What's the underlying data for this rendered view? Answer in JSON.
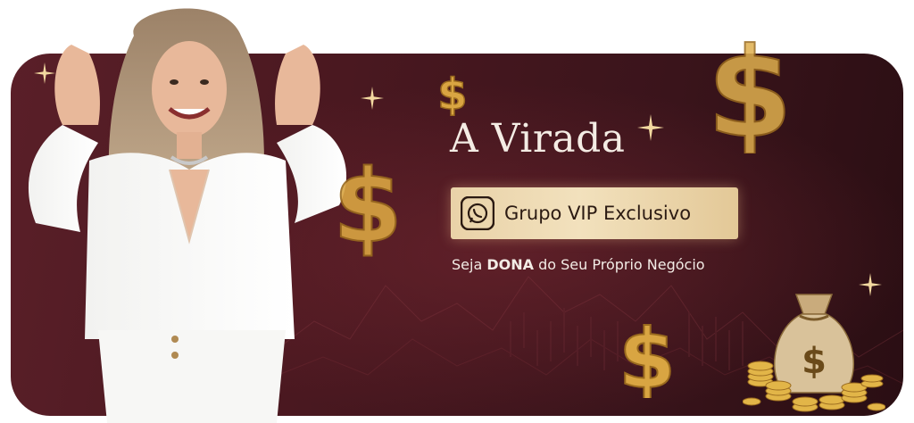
{
  "banner": {
    "title": "A Virada",
    "button_label": "Grupo VIP Exclusivo",
    "button_icon": "whatsapp-icon",
    "tagline_prefix": "Seja ",
    "tagline_bold": "DONA",
    "tagline_suffix": " do Seu Próprio Negócio"
  },
  "colors": {
    "background": "#4a1820",
    "button_gold": "#ecd6ad",
    "text_light": "#f4ece4",
    "coin_gold": "#d9a542"
  }
}
